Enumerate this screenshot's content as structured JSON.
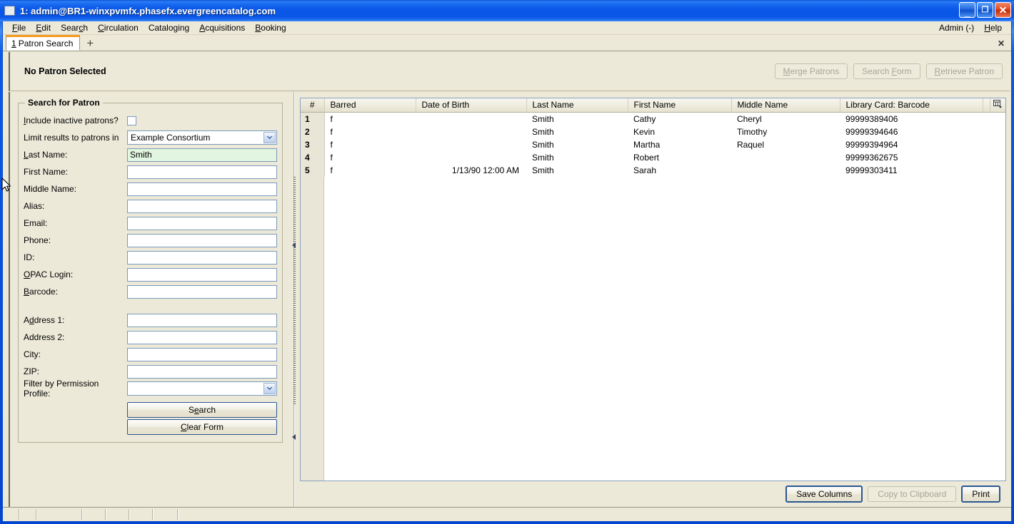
{
  "window": {
    "title": "1: admin@BR1-winxpvmfx.phasefx.evergreencatalog.com",
    "minimize_glyph": "_",
    "maximize_glyph": "❐",
    "close_glyph": "✕"
  },
  "menubar": {
    "items": [
      {
        "accel": "F",
        "rest": "ile"
      },
      {
        "accel": "E",
        "rest": "dit"
      },
      {
        "pre": "Sear",
        "accel": "c",
        "rest": "h"
      },
      {
        "accel": "C",
        "rest": "irculation"
      },
      {
        "pre": "Catalo",
        "accel": "g",
        "rest": "ing"
      },
      {
        "accel": "A",
        "rest": "cquisitions"
      },
      {
        "accel": "B",
        "rest": "ooking"
      }
    ],
    "right_items": [
      {
        "pre": "Admin (-)",
        "accel": "",
        "rest": ""
      },
      {
        "pre": "",
        "accel": "H",
        "rest": "elp"
      }
    ]
  },
  "tabs": {
    "active": {
      "number": "1",
      "label": "Patron Search"
    },
    "add_label": "+",
    "close_all_label": "✕"
  },
  "patron_band": {
    "status": "No Patron Selected",
    "buttons": [
      {
        "accel": "M",
        "pre": "",
        "rest": "erge Patrons",
        "disabled": true
      },
      {
        "pre": "Search ",
        "accel": "F",
        "rest": "orm",
        "disabled": true
      },
      {
        "accel": "R",
        "pre": "",
        "rest": "etrieve Patron",
        "disabled": true
      }
    ]
  },
  "search_form": {
    "legend": "Search for Patron",
    "include_inactive": {
      "label_pre": "",
      "label_accel": "I",
      "label_rest": "nclude inactive patrons?",
      "checked": false
    },
    "limit_results": {
      "label": "Limit results to patrons in",
      "value": "Example Consortium"
    },
    "fields": [
      {
        "id": "last-name",
        "accel": "L",
        "pre": "",
        "rest": "ast Name:",
        "value": "Smith",
        "active": true
      },
      {
        "id": "first-name",
        "accel": "",
        "pre": "First Name:",
        "rest": "",
        "value": "",
        "active": false
      },
      {
        "id": "middle-name",
        "accel": "",
        "pre": "Middle Name:",
        "rest": "",
        "value": "",
        "active": false
      },
      {
        "id": "alias",
        "accel": "",
        "pre": "Alias:",
        "rest": "",
        "value": "",
        "active": false
      },
      {
        "id": "email",
        "accel": "",
        "pre": "Email:",
        "rest": "",
        "value": "",
        "active": false
      },
      {
        "id": "phone",
        "accel": "",
        "pre": "Phone:",
        "rest": "",
        "value": "",
        "active": false
      },
      {
        "id": "patron-id",
        "accel": "",
        "pre": "ID:",
        "rest": "",
        "value": "",
        "active": false
      },
      {
        "id": "opac-login",
        "accel": "O",
        "pre": "",
        "rest": "PAC Login:",
        "value": "",
        "active": false
      },
      {
        "id": "barcode",
        "accel": "B",
        "pre": "",
        "rest": "arcode:",
        "value": "",
        "active": false
      }
    ],
    "address_fields": [
      {
        "id": "address-1",
        "accel": "d",
        "pre": "A",
        "rest": "dress 1:",
        "value": ""
      },
      {
        "id": "address-2",
        "accel": "",
        "pre": "Address 2:",
        "rest": "",
        "value": ""
      },
      {
        "id": "city",
        "accel": "",
        "pre": "City:",
        "rest": "",
        "value": ""
      },
      {
        "id": "zip",
        "accel": "",
        "pre": "ZIP:",
        "rest": "",
        "value": ""
      }
    ],
    "permission_profile": {
      "label": "Filter by Permission Profile:",
      "value": ""
    },
    "search_button": {
      "pre": "S",
      "accel": "e",
      "rest": "arch"
    },
    "clear_button": {
      "pre": "",
      "accel": "C",
      "rest": "lear Form"
    }
  },
  "results": {
    "columns": [
      "#",
      "Barred",
      "Date of Birth",
      "Last Name",
      "First Name",
      "Middle Name",
      "Library Card: Barcode"
    ],
    "column_picker_icon": "column-picker-icon",
    "rows": [
      {
        "num": "1",
        "barred": "f",
        "dob": "",
        "last": "Smith",
        "first": "Cathy",
        "middle": "Cheryl",
        "barcode": "99999389406"
      },
      {
        "num": "2",
        "barred": "f",
        "dob": "",
        "last": "Smith",
        "first": "Kevin",
        "middle": "Timothy",
        "barcode": "99999394646"
      },
      {
        "num": "3",
        "barred": "f",
        "dob": "",
        "last": "Smith",
        "first": "Martha",
        "middle": "Raquel",
        "barcode": "99999394964"
      },
      {
        "num": "4",
        "barred": "f",
        "dob": "",
        "last": "Smith",
        "first": "Robert",
        "middle": "",
        "barcode": "99999362675"
      },
      {
        "num": "5",
        "barred": "f",
        "dob": "1/13/90 12:00 AM",
        "last": "Smith",
        "first": "Sarah",
        "middle": "",
        "barcode": "99999303411"
      }
    ],
    "toolbar": [
      {
        "label": "Save Columns",
        "disabled": false,
        "primary": true
      },
      {
        "label": "Copy to Clipboard",
        "disabled": true,
        "primary": false
      },
      {
        "label": "Print",
        "disabled": false,
        "primary": true
      }
    ]
  },
  "colors": {
    "titlebar_blue": "#0a55e6",
    "window_face": "#ece9d8",
    "active_field_green": "#e2f5e0",
    "tab_accent_orange": "#f59b1e",
    "grid_row_header": "#e9e6d8",
    "field_border_blue": "#7b9abd"
  }
}
